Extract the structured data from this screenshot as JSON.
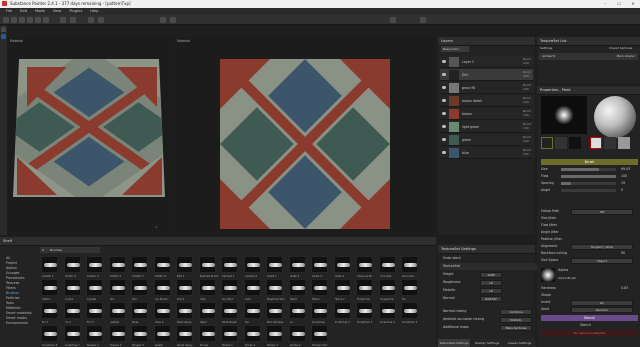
{
  "window": {
    "title": "Substance Painter 2.4.1 - 377 days remaining - [patternTxp]",
    "minimize": "–",
    "maximize": "☐",
    "close": "✕"
  },
  "menu": [
    "File",
    "Edit",
    "Mode",
    "View",
    "Plugins",
    "Help"
  ],
  "viewports": {
    "left_label": "Material",
    "right_label": "Material"
  },
  "layers": {
    "title": "Layers",
    "blend": "Base Color",
    "rows": [
      {
        "name": "Layer 1",
        "op": "Norm 100"
      },
      {
        "name": "Dirt",
        "op": "Norm 100"
      },
      {
        "name": "grout fill",
        "op": "Norm 100"
      },
      {
        "name": "brown detail",
        "op": "Norm 100"
      },
      {
        "name": "brown",
        "op": "Norm 100"
      },
      {
        "name": "light green",
        "op": "Norm 100"
      },
      {
        "name": "green",
        "op": "Norm 100"
      },
      {
        "name": "blue",
        "op": "Norm 100"
      }
    ]
  },
  "textureset_list": {
    "title": "TextureSet List",
    "settings": "Settings",
    "import": "Import textures",
    "item": "lambert1",
    "shader": "Main shader"
  },
  "properties": {
    "title": "Properties - Paint",
    "brush_title": "Brush",
    "rows": [
      {
        "label": "Size",
        "value": "69.03"
      },
      {
        "label": "Flow",
        "value": "100"
      },
      {
        "label": "Spacing",
        "value": "19"
      },
      {
        "label": "Angle",
        "value": "0"
      }
    ],
    "follow_path": "Follow Path",
    "follow_path_val": "Off",
    "jitters": [
      "Size Jitter",
      "Flow Jitter",
      "Angle Jitter",
      "Position Jitter"
    ],
    "alignment_label": "Alignment",
    "alignment_value": "Tangent | Wrap",
    "backface_label": "Backface culling",
    "backface_value": "90",
    "size_space_label": "Size Space",
    "size_space_value": "Object",
    "alpha_title": "Alpha",
    "alpha_name": "Alpha Brush",
    "alpha_rows": [
      "Hardness",
      "Shape",
      "Invert",
      "Seed"
    ],
    "alpha_vals": [
      "0.83",
      "",
      "On",
      "Random"
    ],
    "stencil_title": "Stencil",
    "stencil_sub": "Stencil",
    "stencil_none": "No resource selected"
  },
  "shelf": {
    "title": "Shelf",
    "filter": "Brushes",
    "categories": [
      "All",
      "Project",
      "Alphas",
      "Grunges",
      "Procedurals",
      "Textures",
      "Filters",
      "Brushes",
      "Particles",
      "Tools",
      "Materials",
      "Smart materials",
      "Smart masks",
      "Environments"
    ],
    "rows": [
      [
        "Artistic 1",
        "Artistic 2",
        "Artistic 3",
        "Artistic 4",
        "Artistic 5",
        "Artistic 6",
        "Bird 1",
        "Basmati Brush",
        "Cement 1",
        "Cement 2",
        "Chalk 1",
        "Chalk 2",
        "Chalk 3",
        "Chalk 4",
        "Charcoal Br..",
        "Concrete",
        "Concrete ..."
      ],
      [
        "Cotton",
        "Cracks",
        "Crystal",
        "Dirt",
        "Dot",
        "Dry Brush",
        "Dirt 2",
        "Dots",
        "Dry Mud",
        "Dust",
        "Elephant Skin",
        "Fabric",
        "Fibers",
        "Fibers 2",
        "Footprints",
        "Fingerprint",
        "Fur"
      ],
      [
        "Fur 1",
        "Fur 2",
        "Fur 3",
        "Leather",
        "Moss",
        "Moss 2",
        "Paint Spray",
        "Paper",
        "Paint Brush",
        "Pen",
        "Pure Strokes",
        "Sc...",
        "Scratches",
        "Scratches 2",
        "Scratches 3",
        "Scratches 4",
        "Scratches 5"
      ],
      [
        "Scratches 6",
        "Scratches 7",
        "Shapes 1",
        "Shapes 2",
        "Shapes 3",
        "Splash",
        "Spots Spray",
        "Stones",
        "Stroke 1",
        "Stroke 2",
        "Stroke 3",
        "Stroke 4",
        "Strokes Dirt"
      ]
    ]
  },
  "textureset_settings": {
    "title": "TextureSet Settings",
    "undo_label": "Undo stack",
    "textureset_label": "TextureSet",
    "rows": [
      {
        "label": "Height",
        "value": "128P"
      },
      {
        "label": "Roughness",
        "value": "L8"
      },
      {
        "label": "Metallic",
        "value": "L8"
      },
      {
        "label": "Normal",
        "value": "RGB16F"
      }
    ],
    "normal_mixing_label": "Normal mixing",
    "normal_mixing_value": "Combine",
    "ao_label": "Ambient occlusion mixing",
    "ao_value": "Multiply",
    "additional_label": "Additional maps",
    "bake_label": "Bake textures",
    "tabs": [
      "TextureSet Settings",
      "Display Settings",
      "Viewer Settings"
    ]
  },
  "colors": {
    "brick": "#8a3b2e",
    "tile_blue": "#3c556b",
    "tile_green": "#3f5a52",
    "accent": "#6d6d2a"
  }
}
